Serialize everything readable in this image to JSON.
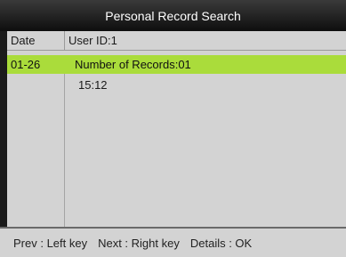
{
  "title": "Personal Record Search",
  "table": {
    "header_date": "Date",
    "header_user": "User ID:1"
  },
  "record": {
    "date": "01-26",
    "summary": "Number of Records:01",
    "time": "15:12"
  },
  "footer": {
    "prev": "Prev : Left key",
    "next": "Next : Right key",
    "details": "Details : OK"
  },
  "colors": {
    "selection": "#aadc3b",
    "panel": "#d3d3d3"
  }
}
